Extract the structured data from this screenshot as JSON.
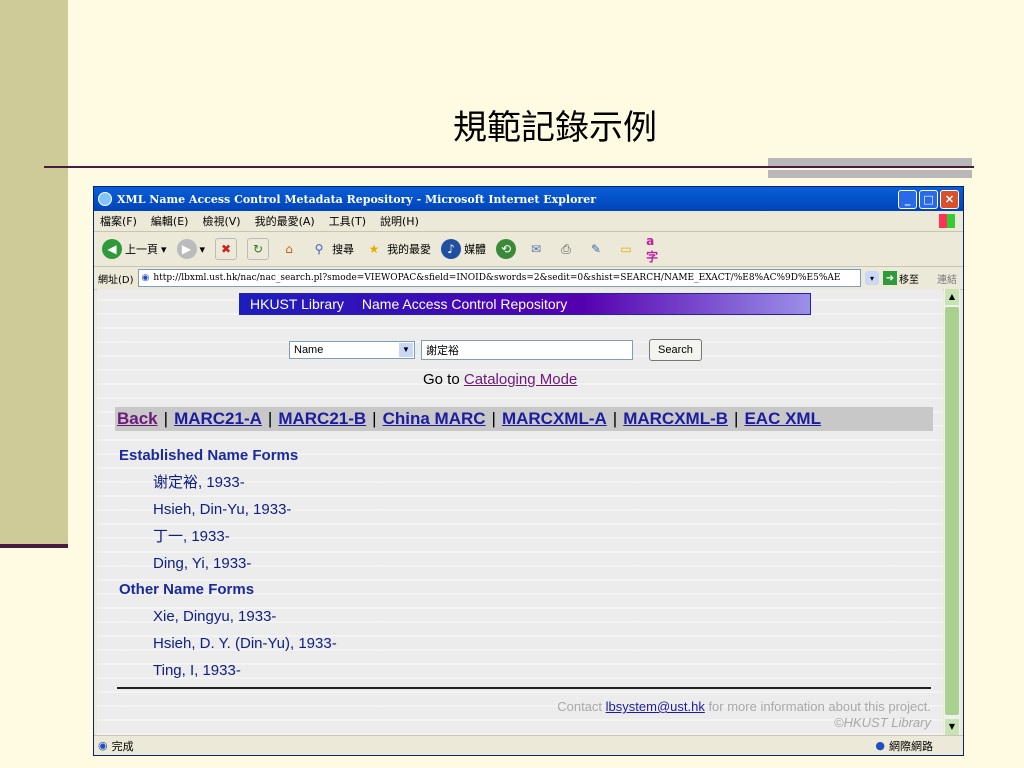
{
  "slide": {
    "title": "規範記錄示例"
  },
  "browser": {
    "window_title": "XML Name Access Control Metadata Repository - Microsoft Internet Explorer",
    "menu": [
      "檔案(F)",
      "編輯(E)",
      "檢視(V)",
      "我的最愛(A)",
      "工具(T)",
      "說明(H)"
    ],
    "toolbar": {
      "back": "上一頁",
      "search": "搜尋",
      "favorites": "我的最愛",
      "media": "媒體"
    },
    "address_label": "網址(D)",
    "address": "http://lbxml.ust.hk/nac/nac_search.pl?smode=VIEWOPAC&sfield=INOID&swords=2&sedit=0&shist=SEARCH/NAME_EXACT/%E8%AC%9D%E5%AE",
    "go_label": "移至",
    "links_label": "連結",
    "status": "完成",
    "zone": "網際網路"
  },
  "page": {
    "banner": {
      "library": "HKUST Library",
      "repo": "Name Access Control Repository"
    },
    "search": {
      "field": "Name",
      "query": "謝定裕",
      "button": "Search"
    },
    "goto": {
      "prefix": "Go to ",
      "link": "Cataloging Mode"
    },
    "tabs": [
      "Back",
      "MARC21-A",
      "MARC21-B",
      "China MARC",
      "MARCXML-A",
      "MARCXML-B",
      "EAC XML"
    ],
    "established_heading": "Established Name Forms",
    "established": [
      "谢定裕, 1933-",
      "Hsieh, Din-Yu, 1933-",
      "丁一, 1933-",
      "Ding, Yi, 1933-"
    ],
    "other_heading": "Other Name Forms",
    "other": [
      "Xie, Dingyu, 1933-",
      "Hsieh, D. Y. (Din-Yu), 1933-",
      "Ting, I, 1933-"
    ],
    "contact": {
      "prefix": "Contact ",
      "email": "lbsystem@ust.hk",
      "suffix": " for more information about this project.",
      "copyright": "©HKUST Library"
    }
  }
}
